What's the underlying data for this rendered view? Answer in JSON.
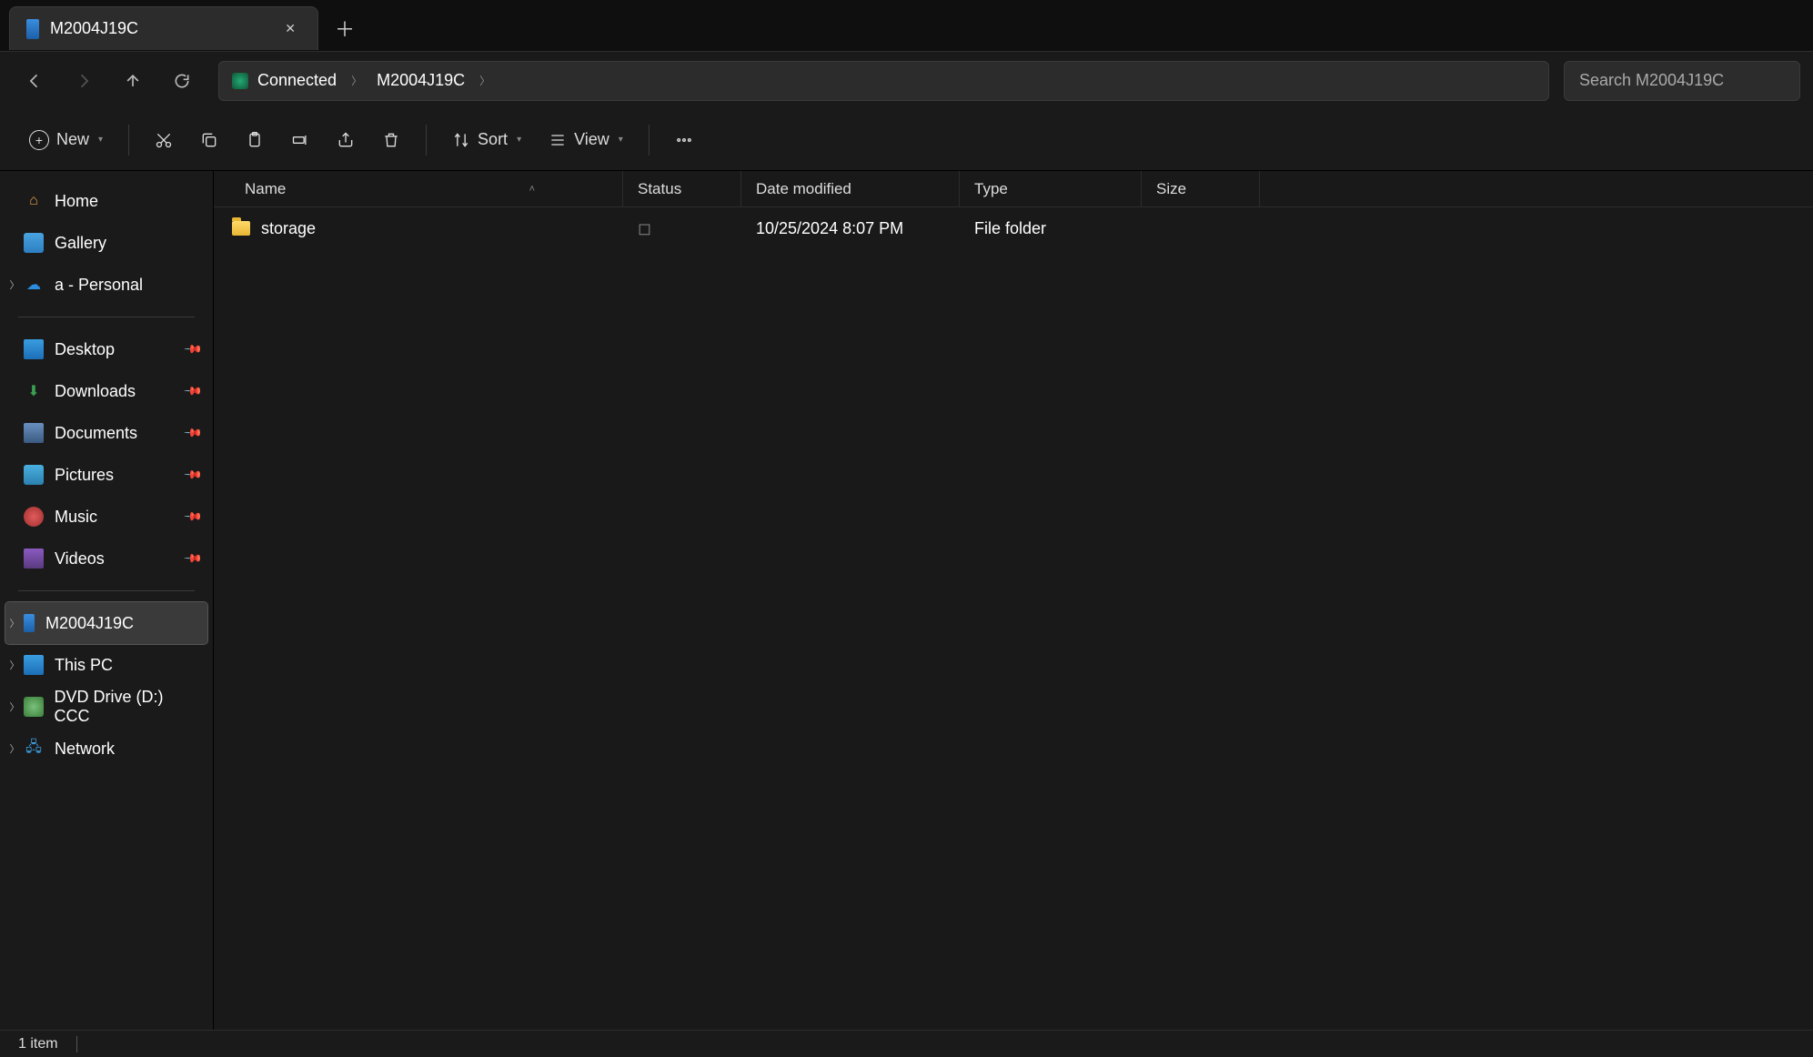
{
  "tab": {
    "title": "M2004J19C"
  },
  "breadcrumb": {
    "root": "Connected",
    "current": "M2004J19C"
  },
  "search": {
    "placeholder": "Search M2004J19C"
  },
  "toolbar": {
    "new": "New",
    "sort": "Sort",
    "view": "View"
  },
  "columns": {
    "name": "Name",
    "status": "Status",
    "date": "Date modified",
    "type": "Type",
    "size": "Size"
  },
  "sidebar": {
    "home": "Home",
    "gallery": "Gallery",
    "onedrive": "a - Personal",
    "desktop": "Desktop",
    "downloads": "Downloads",
    "documents": "Documents",
    "pictures": "Pictures",
    "music": "Music",
    "videos": "Videos",
    "device": "M2004J19C",
    "thispc": "This PC",
    "dvd": "DVD Drive (D:) CCC",
    "network": "Network"
  },
  "files": [
    {
      "name": "storage",
      "status": "◻",
      "date": "10/25/2024 8:07 PM",
      "type": "File folder",
      "size": ""
    }
  ],
  "status": {
    "count": "1 item"
  }
}
